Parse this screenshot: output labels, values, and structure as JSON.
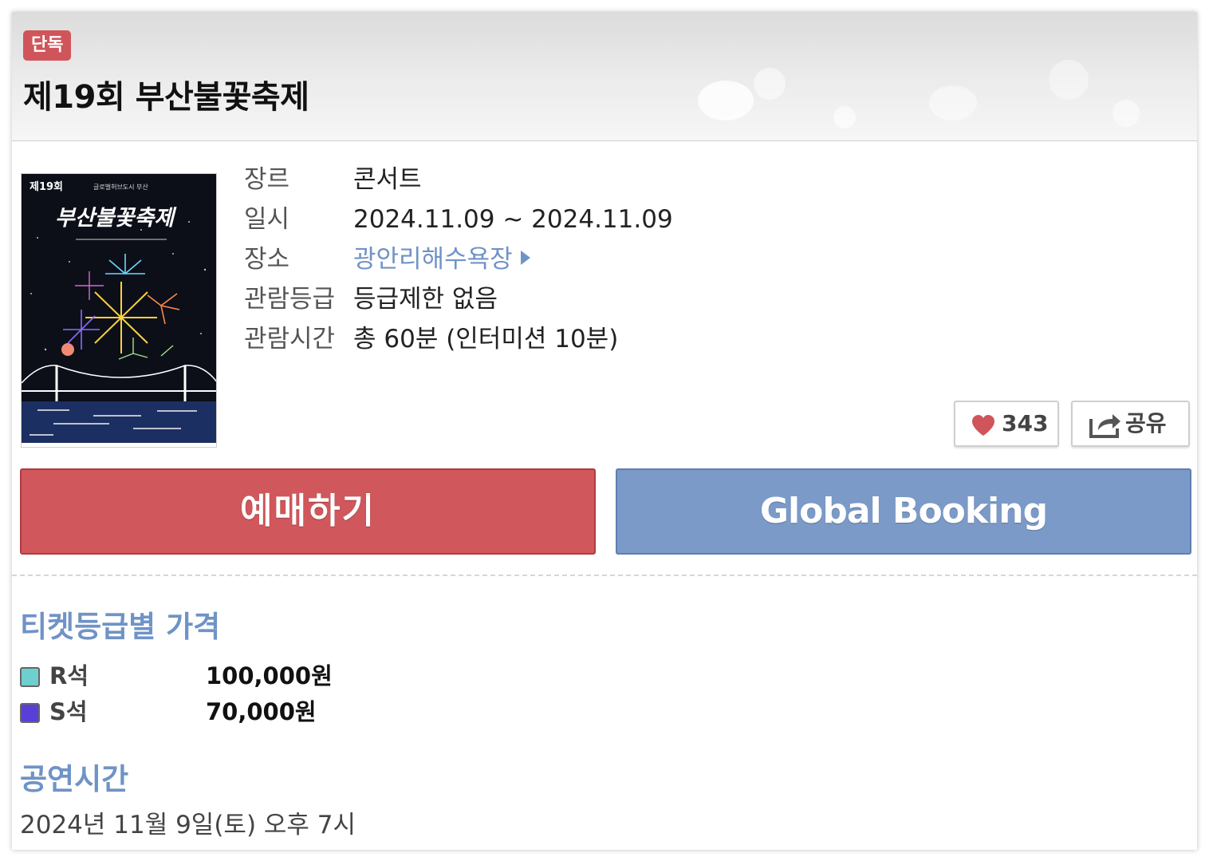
{
  "badge": "단독",
  "title": "제19회 부산불꽃축제",
  "poster": {
    "top_line": "제19회",
    "subtitle": "글로벌허브도시 부산",
    "calligraphy": "부산불꽃축제"
  },
  "info": [
    {
      "label": "장르",
      "value": "콘서트"
    },
    {
      "label": "일시",
      "value": "2024.11.09 ~ 2024.11.09"
    },
    {
      "label": "장소",
      "value": "광안리해수욕장"
    },
    {
      "label": "관람등급",
      "value": "등급제한 없음"
    },
    {
      "label": "관람시간",
      "value": "총 60분 (인터미션 10분)"
    }
  ],
  "actions": {
    "like_count": "343",
    "share_label": "공유",
    "heart_icon": "heart-icon",
    "share_icon": "share-icon"
  },
  "buttons": {
    "book": "예매하기",
    "global": "Global Booking"
  },
  "colors": {
    "book": "#d0575b",
    "global": "#7b9ac8",
    "badge": "#d0555a",
    "accent": "#6f93c6"
  },
  "prices_section": {
    "title": "티켓등급별 가격",
    "rows": [
      {
        "grade": "R석",
        "price": "100,000원",
        "color": "#6ecfcf"
      },
      {
        "grade": "S석",
        "price": "70,000원",
        "color": "#5a3fd6"
      }
    ]
  },
  "showtime_section": {
    "title": "공연시간",
    "text": "2024년 11월 9일(토) 오후 7시"
  }
}
